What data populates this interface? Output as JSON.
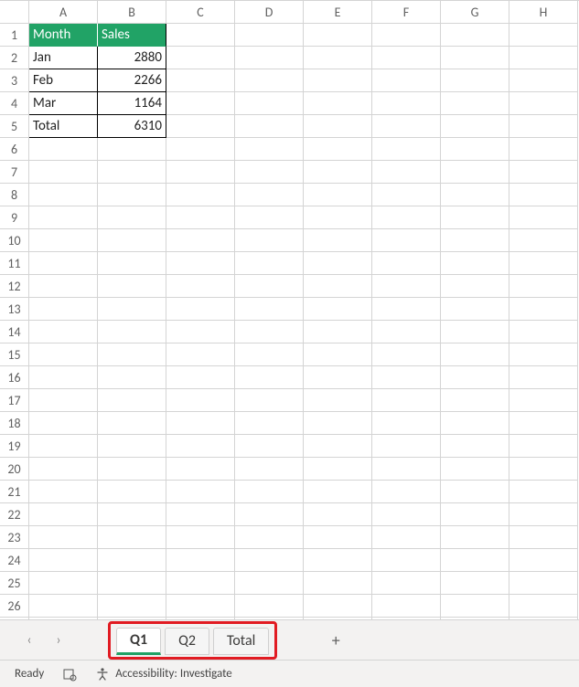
{
  "columns": [
    "A",
    "B",
    "C",
    "D",
    "E",
    "F",
    "G",
    "H"
  ],
  "rowCount": 28,
  "header": {
    "A": "Month",
    "B": "Sales"
  },
  "rows": [
    {
      "A": "Jan",
      "B": "2880"
    },
    {
      "A": "Feb",
      "B": "2266"
    },
    {
      "A": "Mar",
      "B": "1164"
    },
    {
      "A": "Total",
      "B": "6310"
    }
  ],
  "tabs": {
    "items": [
      {
        "label": "Q1",
        "active": true
      },
      {
        "label": "Q2",
        "active": false
      },
      {
        "label": "Total",
        "active": false
      }
    ],
    "add": "+"
  },
  "nav": {
    "prev": "‹",
    "next": "›"
  },
  "status": {
    "ready": "Ready",
    "accessibility": "Accessibility: Investigate"
  }
}
